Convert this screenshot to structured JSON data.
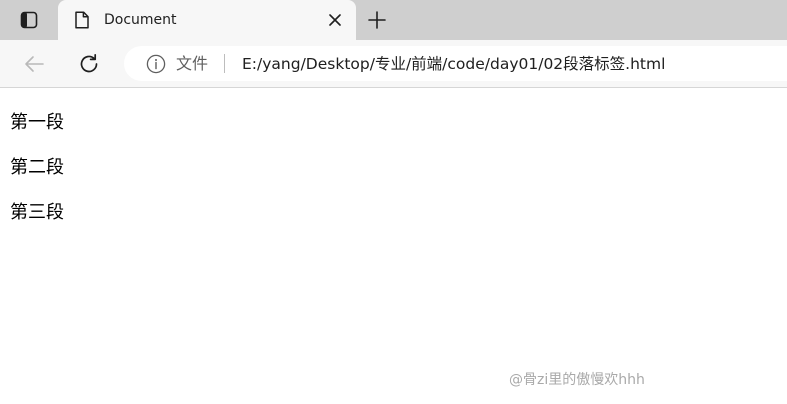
{
  "browser": {
    "tab": {
      "title": "Document"
    },
    "address_bar": {
      "file_label": "文件",
      "url": "E:/yang/Desktop/专业/前端/code/day01/02段落标签.html"
    },
    "icons": {
      "tab_actions": "tab-actions-icon",
      "page": "page-icon",
      "close": "close-icon",
      "new_tab": "plus-icon",
      "back": "back-arrow-icon",
      "reload": "reload-icon",
      "info": "info-icon"
    }
  },
  "content": {
    "paragraphs": [
      "第一段",
      "第二段",
      "第三段"
    ]
  },
  "watermark": {
    "text": "@骨zi里的傲慢欢hhh"
  }
}
